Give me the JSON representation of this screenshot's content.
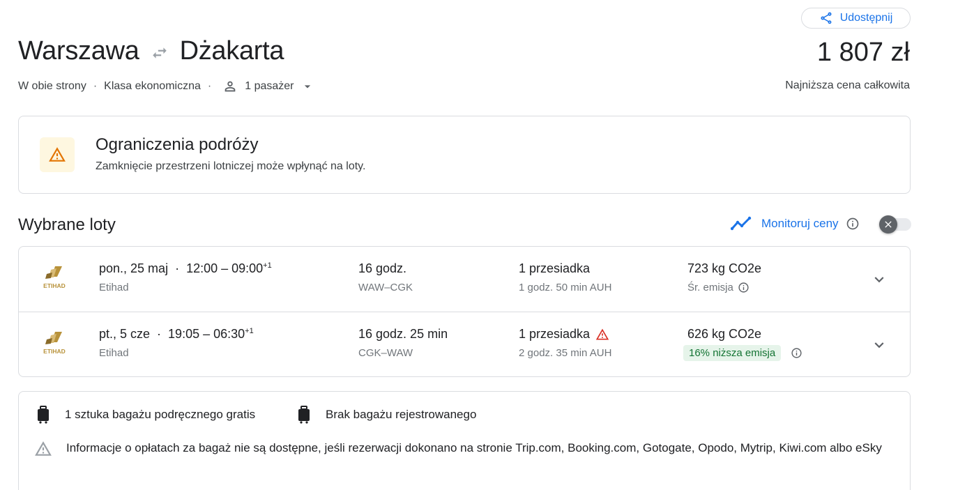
{
  "header": {
    "share_label": "Udostępnij",
    "origin": "Warszawa",
    "destination": "Dżakarta",
    "price": "1 807 zł",
    "price_note": "Najniższa cena całkowita",
    "trip_type": "W obie strony",
    "cabin_class": "Klasa ekonomiczna",
    "passengers": "1 pasażer"
  },
  "alert": {
    "title": "Ograniczenia podróży",
    "text": "Zamknięcie przestrzeni lotniczej może wpłynąć na loty."
  },
  "selected": {
    "title": "Wybrane loty",
    "monitor_label": "Monitoruj ceny"
  },
  "flights": [
    {
      "date": "pon., 25 maj",
      "times": "12:00 – 09:00",
      "day_offset": "+1",
      "airline": "Etihad",
      "duration": "16 godz.",
      "route": "WAW–CGK",
      "stops": "1 przesiadka",
      "layover": "1 godz. 50 min AUH",
      "co2": "723 kg CO2e",
      "emission_note": "Śr. emisja"
    },
    {
      "date": "pt., 5 cze",
      "times": "19:05 – 06:30",
      "day_offset": "+1",
      "airline": "Etihad",
      "duration": "16 godz. 25 min",
      "route": "CGK–WAW",
      "stops": "1 przesiadka",
      "layover": "2 godz. 35 min AUH",
      "co2": "626 kg CO2e",
      "emission_note": "16% niższa emisja"
    }
  ],
  "baggage": {
    "carry_on": "1 sztuka bagażu podręcznego gratis",
    "checked": "Brak bagażu rejestrowanego",
    "note": "Informacje o opłatach za bagaż nie są dostępne, jeśli rezerwacji dokonano na stronie Trip.com, Booking.com, Gotogate, Opodo, Mytrip, Kiwi.com albo eSky"
  },
  "logo_text": "ETIHAD",
  "colors": {
    "accent": "#1a73e8",
    "warning": "#d93025",
    "alert_bg": "#fef7e0",
    "alert_icon": "#e37400",
    "eco_bg": "#e6f4ea",
    "eco_text": "#137333"
  },
  "icons": [
    "share-icon",
    "swap-arrows-icon",
    "person-icon",
    "caret-down-icon",
    "warning-icon",
    "trend-icon",
    "info-icon",
    "close-icon",
    "chevron-down-icon",
    "luggage-icon"
  ]
}
